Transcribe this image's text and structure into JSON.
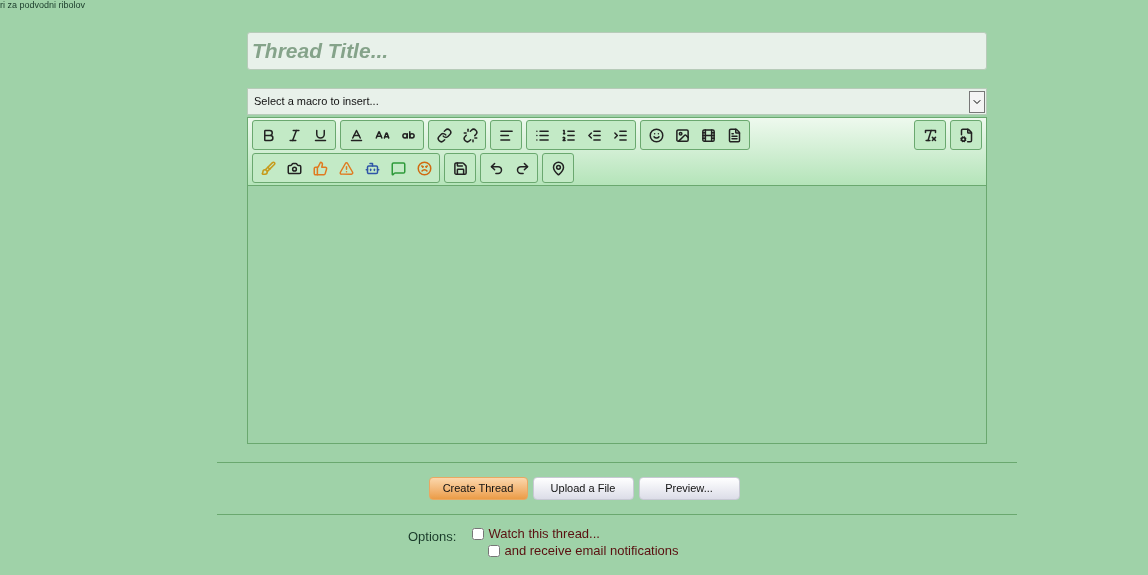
{
  "top_link": "ri za podvodni ribolov",
  "title_field": {
    "placeholder": "Thread Title..."
  },
  "macro_select": {
    "value": "Select a macro to insert..."
  },
  "buttons": [
    {
      "label": "Create Thread",
      "kind": "primary"
    },
    {
      "label": "Upload a File",
      "kind": "secondary"
    },
    {
      "label": "Preview...",
      "kind": "secondary"
    }
  ],
  "options": {
    "label": "Options:",
    "items": [
      {
        "label": "Watch this thread...",
        "checked": false
      },
      {
        "label": "and receive email notifications",
        "checked": false
      }
    ]
  }
}
